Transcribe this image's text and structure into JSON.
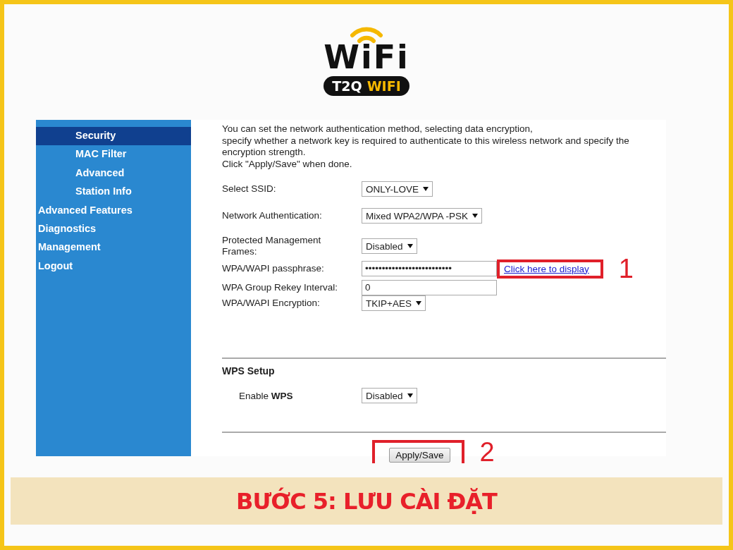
{
  "logo": {
    "wordmark": "WiFi",
    "badge_left": "T2Q",
    "badge_right": "WIFI"
  },
  "sidebar": {
    "items": [
      {
        "label": "Security",
        "kind": "subitem",
        "selected": true
      },
      {
        "label": "MAC Filter",
        "kind": "subitem",
        "selected": false
      },
      {
        "label": "Advanced",
        "kind": "subitem",
        "selected": false
      },
      {
        "label": "Station Info",
        "kind": "subitem",
        "selected": false
      },
      {
        "label": "Advanced Features",
        "kind": "item",
        "selected": false
      },
      {
        "label": "Diagnostics",
        "kind": "item",
        "selected": false
      },
      {
        "label": "Management",
        "kind": "item",
        "selected": false
      },
      {
        "label": "Logout",
        "kind": "item",
        "selected": false
      }
    ]
  },
  "intro": [
    "You can set the network authentication method, selecting data encryption,",
    "specify whether a network key is required to authenticate to this wireless network and specify the",
    "encryption strength.",
    "Click \"Apply/Save\" when done."
  ],
  "fields": [
    {
      "label": "Select SSID:",
      "kind": "select",
      "value": "ONLY-LOVE"
    },
    {
      "label": "Network Authentication:",
      "kind": "select",
      "value": "Mixed WPA2/WPA -PSK"
    },
    {
      "label": "Protected Management Frames:",
      "kind": "select",
      "value": "Disabled"
    },
    {
      "label": "WPA/WAPI passphrase:",
      "kind": "text",
      "value": "••••••••••••••••••••••••••",
      "link": "Click here to display",
      "annotation": "1"
    },
    {
      "label": "WPA Group Rekey Interval:",
      "kind": "text",
      "value": "0"
    },
    {
      "label": "WPA/WAPI Encryption:",
      "kind": "select",
      "value": "TKIP+AES"
    }
  ],
  "wps": {
    "title": "WPS Setup",
    "label": "Enable **WPS**",
    "value": "Disabled"
  },
  "apply": {
    "label": "Apply/Save",
    "annotation": "2"
  },
  "banner": "BƯỚC 5: LƯU CÀI ĐẶT"
}
